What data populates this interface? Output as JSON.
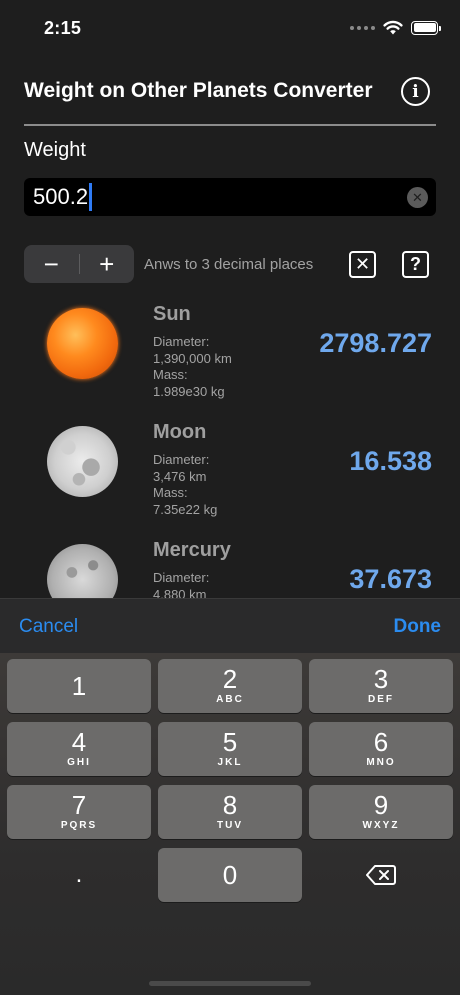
{
  "status": {
    "time": "2:15"
  },
  "header": {
    "title": "Weight on Other Planets Converter"
  },
  "form": {
    "weight_label": "Weight",
    "weight_value": "500.2",
    "decimal_text": "Anws to 3 decimal places"
  },
  "planets": [
    {
      "name": "Sun",
      "diameter_label": "Diameter:",
      "diameter": "1,390,000 km",
      "mass_label": "Mass:",
      "mass": "1.989e30 kg",
      "weight": "2798.727"
    },
    {
      "name": "Moon",
      "diameter_label": "Diameter:",
      "diameter": "3,476 km",
      "mass_label": "Mass:",
      "mass": "7.35e22 kg",
      "weight": "16.538"
    },
    {
      "name": "Mercury",
      "diameter_label": "Diameter:",
      "diameter": "4,880 km",
      "weight": "37.673"
    }
  ],
  "keyboard": {
    "cancel": "Cancel",
    "done": "Done",
    "keys": [
      {
        "num": "1",
        "letters": ""
      },
      {
        "num": "2",
        "letters": "ABC"
      },
      {
        "num": "3",
        "letters": "DEF"
      },
      {
        "num": "4",
        "letters": "GHI"
      },
      {
        "num": "5",
        "letters": "JKL"
      },
      {
        "num": "6",
        "letters": "MNO"
      },
      {
        "num": "7",
        "letters": "PQRS"
      },
      {
        "num": "8",
        "letters": "TUV"
      },
      {
        "num": "9",
        "letters": "WXYZ"
      },
      {
        "num": "0",
        "letters": ""
      }
    ],
    "decimal": "."
  },
  "colors": {
    "accent": "#2b8cf0",
    "result": "#6fa8ec",
    "background": "#1e1e1e"
  }
}
